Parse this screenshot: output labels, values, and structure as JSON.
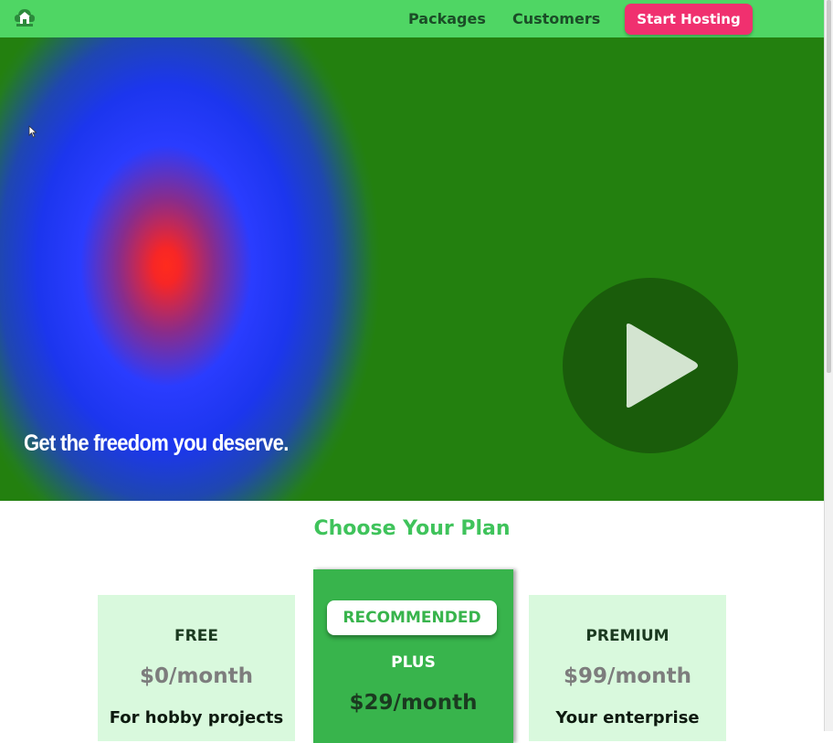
{
  "nav": {
    "links": [
      "Packages",
      "Customers"
    ],
    "cta_label": "Start Hosting",
    "logo_icon": "house-cloud-logo-icon"
  },
  "hero": {
    "tagline": "Get the freedom you deserve.",
    "play_icon": "play-icon"
  },
  "plans": {
    "title": "Choose Your Plan",
    "cards": [
      {
        "name": "FREE",
        "price": "$0/month",
        "desc": "For hobby projects"
      },
      {
        "badge": "RECOMMENDED",
        "name": "PLUS",
        "price": "$29/month"
      },
      {
        "name": "PREMIUM",
        "price": "$99/month",
        "desc": "Your enterprise"
      }
    ]
  },
  "colors": {
    "nav_bg": "#4fd664",
    "cta": "#f0306f",
    "hero_green": "#23800f",
    "accent_green": "#3fc35b"
  }
}
